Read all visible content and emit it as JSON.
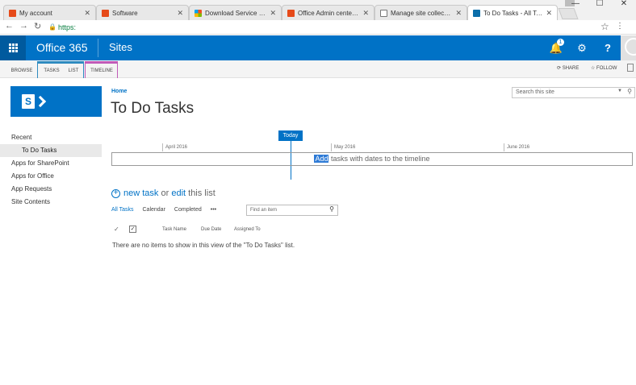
{
  "browser": {
    "tabs": [
      {
        "title": "My account",
        "favicon": "office-icon"
      },
      {
        "title": "Software",
        "favicon": "office-icon"
      },
      {
        "title": "Download Service Pack",
        "favicon": "microsoft-icon"
      },
      {
        "title": "Office Admin center pre",
        "favicon": "office-icon"
      },
      {
        "title": "Manage site collections",
        "favicon": "document-icon"
      },
      {
        "title": "To Do Tasks - All Tasks",
        "favicon": "sharepoint-icon",
        "active": true
      }
    ],
    "close_glyph": "✕",
    "window_controls": {
      "minimize": "—",
      "maximize": "☐",
      "close": "✕"
    },
    "address": {
      "protocol_label": "https:"
    }
  },
  "suitebar": {
    "brand": "Office 365",
    "app": "Sites",
    "notifications_count": "1",
    "help": "?"
  },
  "ribbon": {
    "tabs": [
      "BROWSE",
      "TASKS",
      "LIST",
      "TIMELINE"
    ],
    "share_label": "SHARE",
    "follow_label": "FOLLOW"
  },
  "leftnav": {
    "items": [
      "Recent",
      "To Do Tasks",
      "Apps for SharePoint",
      "Apps for Office",
      "App Requests",
      "Site Contents"
    ]
  },
  "page": {
    "breadcrumb": "Home",
    "title": "To Do Tasks",
    "search_placeholder": "Search this site"
  },
  "timeline": {
    "today_label": "Today",
    "months": [
      "April 2016",
      "May 2016",
      "June 2016"
    ],
    "empty_highlight": "Add",
    "empty_rest": " tasks with dates to the timeline"
  },
  "list": {
    "new_label": "new task",
    "or_label": " or ",
    "edit_label": "edit",
    "this_list_label": " this list",
    "views": [
      "All Tasks",
      "Calendar",
      "Completed",
      "•••"
    ],
    "find_placeholder": "Find an item",
    "columns": [
      "Task Name",
      "Due Date",
      "Assigned To"
    ],
    "empty_message": "There are no items to show in this view of the \"To Do Tasks\" list."
  },
  "colors": {
    "suite_blue": "#0072c6",
    "timeline_tab_accent": "#c15ab8"
  }
}
